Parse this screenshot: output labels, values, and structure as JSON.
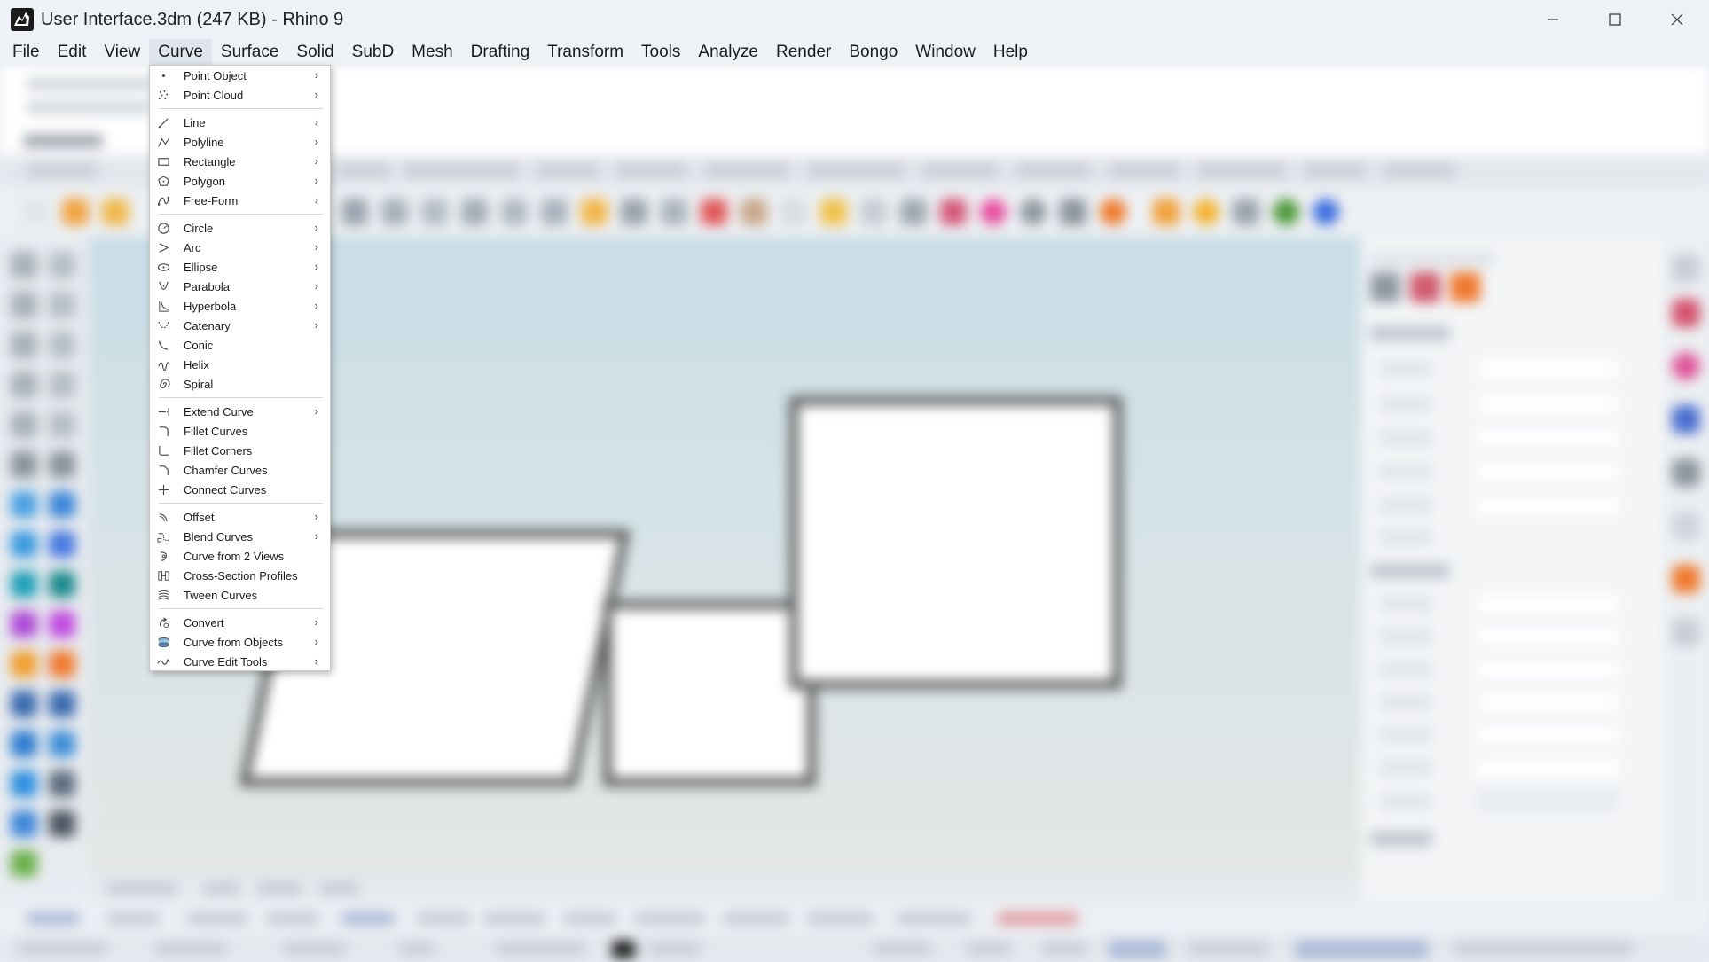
{
  "window": {
    "title": "User Interface.3dm (247 KB) - Rhino 9",
    "controls": {
      "minimize": "minimize",
      "maximize": "maximize",
      "close": "close"
    }
  },
  "menubar": {
    "items": [
      "File",
      "Edit",
      "View",
      "Curve",
      "Surface",
      "Solid",
      "SubD",
      "Mesh",
      "Drafting",
      "Transform",
      "Tools",
      "Analyze",
      "Render",
      "Bongo",
      "Window",
      "Help"
    ],
    "active": "Curve"
  },
  "curve_menu": {
    "groups": [
      [
        {
          "label": "Point Object",
          "icon": "point-icon",
          "submenu": true
        },
        {
          "label": "Point Cloud",
          "icon": "point-cloud-icon",
          "submenu": true
        }
      ],
      [
        {
          "label": "Line",
          "icon": "line-icon",
          "submenu": true
        },
        {
          "label": "Polyline",
          "icon": "polyline-icon",
          "submenu": true
        },
        {
          "label": "Rectangle",
          "icon": "rectangle-icon",
          "submenu": true
        },
        {
          "label": "Polygon",
          "icon": "polygon-icon",
          "submenu": true
        },
        {
          "label": "Free-Form",
          "icon": "free-form-icon",
          "submenu": true
        }
      ],
      [
        {
          "label": "Circle",
          "icon": "circle-icon",
          "submenu": true
        },
        {
          "label": "Arc",
          "icon": "arc-icon",
          "submenu": true
        },
        {
          "label": "Ellipse",
          "icon": "ellipse-icon",
          "submenu": true
        },
        {
          "label": "Parabola",
          "icon": "parabola-icon",
          "submenu": true
        },
        {
          "label": "Hyperbola",
          "icon": "hyperbola-icon",
          "submenu": true
        },
        {
          "label": "Catenary",
          "icon": "catenary-icon",
          "submenu": true
        },
        {
          "label": "Conic",
          "icon": "conic-icon",
          "submenu": false
        },
        {
          "label": "Helix",
          "icon": "helix-icon",
          "submenu": false
        },
        {
          "label": "Spiral",
          "icon": "spiral-icon",
          "submenu": false
        }
      ],
      [
        {
          "label": "Extend Curve",
          "icon": "extend-curve-icon",
          "submenu": true
        },
        {
          "label": "Fillet Curves",
          "icon": "fillet-curves-icon",
          "submenu": false
        },
        {
          "label": "Fillet Corners",
          "icon": "fillet-corners-icon",
          "submenu": false
        },
        {
          "label": "Chamfer Curves",
          "icon": "chamfer-curves-icon",
          "submenu": false
        },
        {
          "label": "Connect Curves",
          "icon": "connect-curves-icon",
          "submenu": false
        }
      ],
      [
        {
          "label": "Offset",
          "icon": "offset-icon",
          "submenu": true
        },
        {
          "label": "Blend Curves",
          "icon": "blend-curves-icon",
          "submenu": true
        },
        {
          "label": "Curve from 2 Views",
          "icon": "curve-from-2-views-icon",
          "submenu": false
        },
        {
          "label": "Cross-Section Profiles",
          "icon": "cross-section-icon",
          "submenu": false
        },
        {
          "label": "Tween Curves",
          "icon": "tween-curves-icon",
          "submenu": false
        }
      ],
      [
        {
          "label": "Convert",
          "icon": "convert-icon",
          "submenu": true
        },
        {
          "label": "Curve from Objects",
          "icon": "curve-from-objects-icon",
          "submenu": true
        },
        {
          "label": "Curve Edit Tools",
          "icon": "curve-edit-tools-icon",
          "submenu": true
        }
      ]
    ],
    "submenu_glyph": "›"
  },
  "colors": {
    "accent": "#3b82f6",
    "menu_bg": "#ffffff",
    "titlebar_bg": "#eef1f6",
    "icon_stroke": "#444444"
  }
}
